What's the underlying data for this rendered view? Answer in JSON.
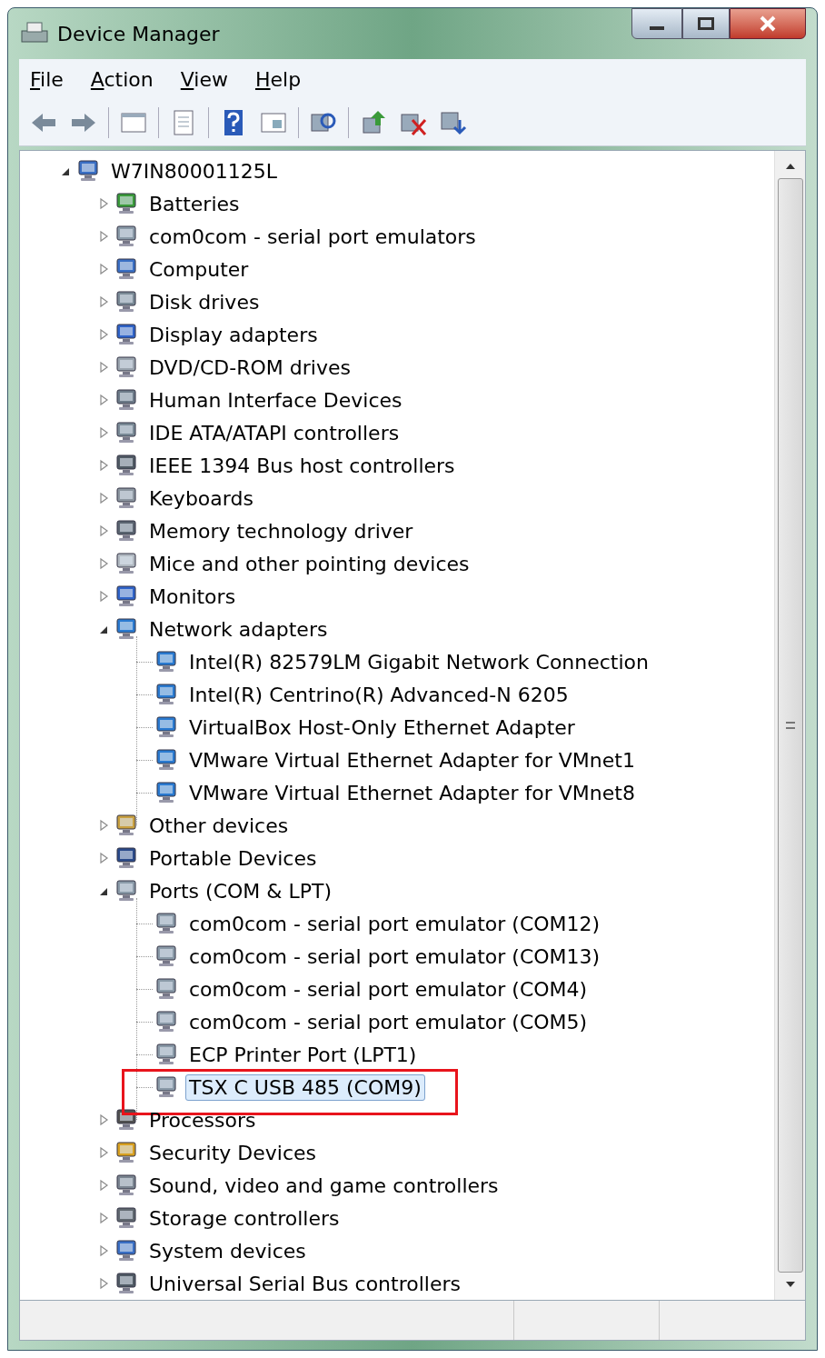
{
  "window": {
    "title": "Device Manager"
  },
  "menu": [
    {
      "label": "File",
      "underline_first": true
    },
    {
      "label": "Action",
      "underline_first": true
    },
    {
      "label": "View",
      "underline_first": true
    },
    {
      "label": "Help",
      "underline_first": true
    }
  ],
  "tree": [
    {
      "label": "W7IN80001125L",
      "kind": "computer",
      "expanded": true,
      "selected": false,
      "children": [
        {
          "label": "Batteries",
          "kind": "battery",
          "expanded": false,
          "selected": false
        },
        {
          "label": "com0com - serial port emulators",
          "kind": "port",
          "expanded": false,
          "selected": false
        },
        {
          "label": "Computer",
          "kind": "computer",
          "expanded": false,
          "selected": false
        },
        {
          "label": "Disk drives",
          "kind": "disk",
          "expanded": false,
          "selected": false
        },
        {
          "label": "Display adapters",
          "kind": "display",
          "expanded": false,
          "selected": false
        },
        {
          "label": "DVD/CD-ROM drives",
          "kind": "optical",
          "expanded": false,
          "selected": false
        },
        {
          "label": "Human Interface Devices",
          "kind": "hid",
          "expanded": false,
          "selected": false
        },
        {
          "label": "IDE ATA/ATAPI controllers",
          "kind": "disk",
          "expanded": false,
          "selected": false
        },
        {
          "label": "IEEE 1394 Bus host controllers",
          "kind": "usb",
          "expanded": false,
          "selected": false
        },
        {
          "label": "Keyboards",
          "kind": "keyboard",
          "expanded": false,
          "selected": false
        },
        {
          "label": "Memory technology driver",
          "kind": "memory",
          "expanded": false,
          "selected": false
        },
        {
          "label": "Mice and other pointing devices",
          "kind": "mouse",
          "expanded": false,
          "selected": false
        },
        {
          "label": "Monitors",
          "kind": "display",
          "expanded": false,
          "selected": false
        },
        {
          "label": "Network adapters",
          "kind": "network",
          "expanded": true,
          "selected": false,
          "children": [
            {
              "label": "Intel(R) 82579LM Gigabit Network Connection",
              "kind": "network",
              "selected": false,
              "annotated": false
            },
            {
              "label": "Intel(R) Centrino(R) Advanced-N 6205",
              "kind": "network",
              "selected": false,
              "annotated": false
            },
            {
              "label": "VirtualBox Host-Only Ethernet Adapter",
              "kind": "network",
              "selected": false,
              "annotated": false
            },
            {
              "label": "VMware Virtual Ethernet Adapter for VMnet1",
              "kind": "network",
              "selected": false,
              "annotated": false
            },
            {
              "label": "VMware Virtual Ethernet Adapter for VMnet8",
              "kind": "network",
              "selected": false,
              "annotated": false
            }
          ]
        },
        {
          "label": "Other devices",
          "kind": "other",
          "expanded": false,
          "selected": false
        },
        {
          "label": "Portable Devices",
          "kind": "portable",
          "expanded": false,
          "selected": false
        },
        {
          "label": "Ports (COM & LPT)",
          "kind": "port",
          "expanded": true,
          "selected": false,
          "children": [
            {
              "label": "com0com - serial port emulator (COM12)",
              "kind": "port",
              "selected": false,
              "annotated": false
            },
            {
              "label": "com0com - serial port emulator (COM13)",
              "kind": "port",
              "selected": false,
              "annotated": false
            },
            {
              "label": "com0com - serial port emulator (COM4)",
              "kind": "port",
              "selected": false,
              "annotated": false
            },
            {
              "label": "com0com - serial port emulator (COM5)",
              "kind": "port",
              "selected": false,
              "annotated": false
            },
            {
              "label": "ECP Printer Port (LPT1)",
              "kind": "port",
              "selected": false,
              "annotated": false
            },
            {
              "label": "TSX C USB 485 (COM9)",
              "kind": "port",
              "selected": true,
              "annotated": true
            }
          ]
        },
        {
          "label": "Processors",
          "kind": "processor",
          "expanded": false,
          "selected": false
        },
        {
          "label": "Security Devices",
          "kind": "security",
          "expanded": false,
          "selected": false
        },
        {
          "label": "Sound, video and game controllers",
          "kind": "sound",
          "expanded": false,
          "selected": false
        },
        {
          "label": "Storage controllers",
          "kind": "storage",
          "expanded": false,
          "selected": false
        },
        {
          "label": "System devices",
          "kind": "computer",
          "expanded": false,
          "selected": false
        },
        {
          "label": "Universal Serial Bus controllers",
          "kind": "usb",
          "expanded": false,
          "selected": false
        }
      ]
    }
  ]
}
